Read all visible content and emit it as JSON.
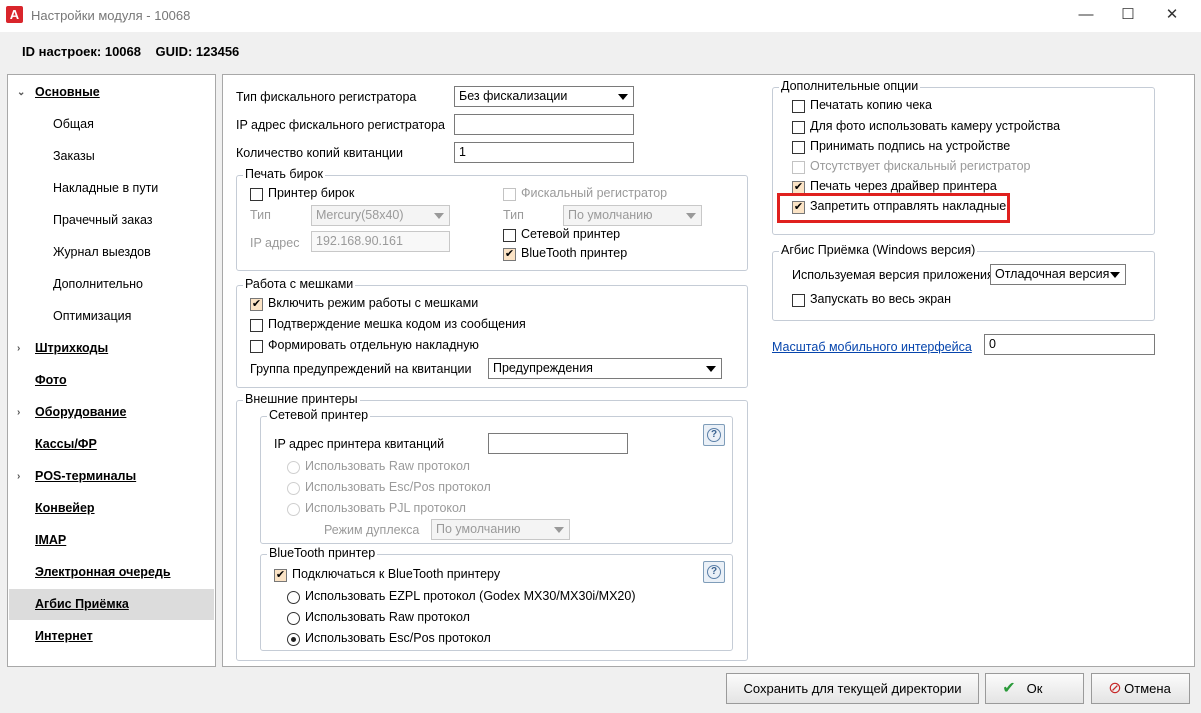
{
  "window": {
    "title": "Настройки модуля - 10068",
    "app_icon": "A"
  },
  "header": {
    "id_label": "ID настроек: 10068",
    "guid_label": "GUID: 123456"
  },
  "nav": {
    "items": [
      {
        "label": "Основные",
        "level": "top",
        "expanded": true
      },
      {
        "label": "Общая",
        "level": "sub"
      },
      {
        "label": "Заказы",
        "level": "sub"
      },
      {
        "label": "Накладные в пути",
        "level": "sub"
      },
      {
        "label": "Прачечный заказ",
        "level": "sub"
      },
      {
        "label": "Журнал выездов",
        "level": "sub"
      },
      {
        "label": "Дополнительно",
        "level": "sub"
      },
      {
        "label": "Оптимизация",
        "level": "sub"
      },
      {
        "label": "Штрихкоды",
        "level": "top",
        "collapsed": true
      },
      {
        "label": "Фото",
        "level": "top"
      },
      {
        "label": "Оборудование",
        "level": "top",
        "collapsed": true
      },
      {
        "label": "Кассы/ФР",
        "level": "top"
      },
      {
        "label": "POS-терминалы",
        "level": "top",
        "collapsed": true
      },
      {
        "label": "Конвейер",
        "level": "top"
      },
      {
        "label": "IMAP",
        "level": "top"
      },
      {
        "label": "Электронная очередь",
        "level": "top"
      },
      {
        "label": "Агбис Приёмка",
        "level": "top",
        "selected": true
      },
      {
        "label": "Интернет",
        "level": "top"
      }
    ]
  },
  "fiscal": {
    "type_label": "Тип фискального регистратора",
    "type_value": "Без фискализации",
    "ip_label": "IP адрес фискального регистратора",
    "ip_value": "",
    "copies_label": "Количество копий квитанции",
    "copies_value": "1"
  },
  "tags": {
    "title": "Печать бирок",
    "tag_printer": "Принтер бирок",
    "fiscal_reg": "Фискальный регистратор",
    "type_label": "Тип",
    "type_value": "Mercury(58x40)",
    "type2_label": "Тип",
    "type2_value": "По умолчанию",
    "ip_label": "IP адрес",
    "ip_value": "192.168.90.161",
    "network_printer": "Сетевой принтер",
    "bluetooth_printer": "BlueTooth принтер"
  },
  "bags": {
    "title": "Работа с мешками",
    "enable": "Включить режим работы с мешками",
    "confirm": "Подтверждение мешка кодом из сообщения",
    "separate": "Формировать отдельную накладную",
    "warn_group_label": "Группа предупреждений на квитанции",
    "warn_group_value": "Предупреждения"
  },
  "ext": {
    "title": "Внешние принтеры",
    "net_title": "Сетевой принтер",
    "ip_label": "IP адрес принтера квитанций",
    "ip_value": "",
    "raw": "Использовать Raw протокол",
    "escpos": "Использовать Esc/Pos протокол",
    "pjl": "Использовать PJL протокол",
    "duplex_label": "Режим дуплекса",
    "duplex_value": "По умолчанию",
    "bt_title": "BlueTooth принтер",
    "bt_connect": "Подключаться к BlueTooth принтеру",
    "bt_ezpl": "Использовать EZPL протокол (Godex MX30/MX30i/MX20)",
    "bt_raw": "Использовать Raw протокол",
    "bt_escpos": "Использовать Esc/Pos протокол",
    "help": "?"
  },
  "extra": {
    "title": "Дополнительные опции",
    "print_copy": "Печатать копию чека",
    "camera": "Для фото использовать камеру устройства",
    "signature": "Принимать подпись на устройстве",
    "no_fiscal": "Отсутствует фискальный регистратор",
    "driver_print": "Печать через драйвер принтера",
    "forbid_send": "Запретить отправлять накладные"
  },
  "windows": {
    "title": "Агбис Приёмка (Windows версия)",
    "version_label": "Используемая версия приложения",
    "version_value": "Отладочная версия",
    "fullscreen": "Запускать во весь экран"
  },
  "scale": {
    "label": "Масштаб мобильного интерфейса",
    "value": "0"
  },
  "buttons": {
    "save": "Сохранить для текущей директории",
    "ok": "Ок",
    "cancel": "Отмена"
  },
  "colors": {
    "highlight": "#e0201e",
    "accent": "#d9252b",
    "check_ok": "#2a9a3a",
    "cancel_icon": "#c62828"
  }
}
